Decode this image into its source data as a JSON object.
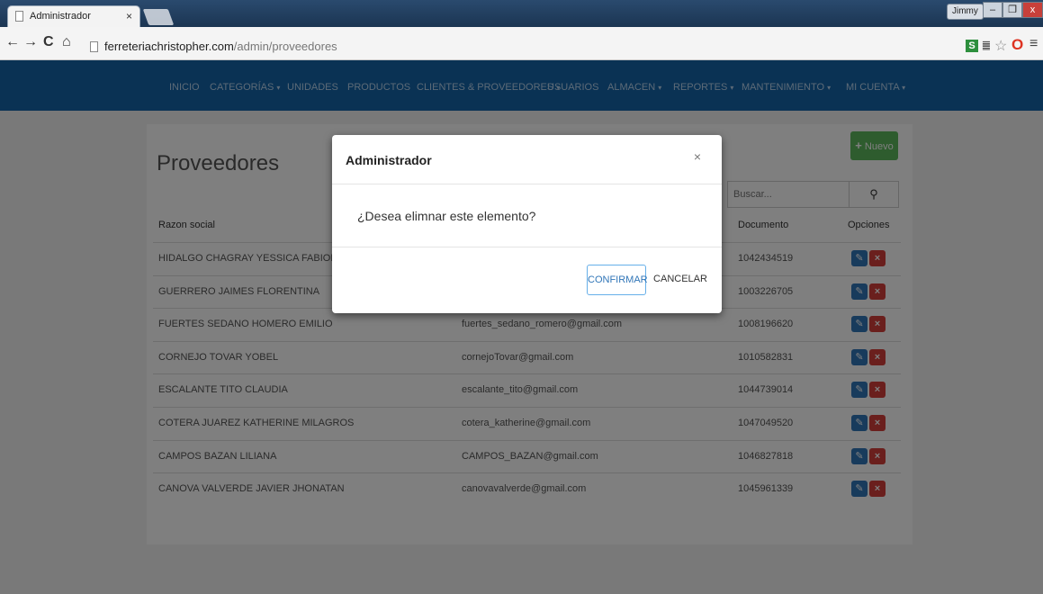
{
  "browser": {
    "tab_title": "Administrador",
    "tab_close": "×",
    "url_domain": "ferreteriachristopher.com",
    "url_path": "/admin/proveedores",
    "user": "Jimmy",
    "win_min": "–",
    "win_max": "❐",
    "win_close": "x",
    "back_icon": "←",
    "forward_icon": "→",
    "reload_icon": "C",
    "home_icon": "⌂",
    "ext_s": "S",
    "ext_t": "䷀",
    "star_icon": "☆",
    "opera_icon": "O",
    "menu_icon": "≡"
  },
  "nav": {
    "items": [
      {
        "label": "INICIO",
        "caret": false
      },
      {
        "label": "CATEGORÍAS",
        "caret": true
      },
      {
        "label": "UNIDADES",
        "caret": false
      },
      {
        "label": "PRODUCTOS",
        "caret": false
      },
      {
        "label": "CLIENTES & PROVEEDORES",
        "caret": true
      },
      {
        "label": "USUARIOS",
        "caret": false
      },
      {
        "label": "ALMACEN",
        "caret": true
      },
      {
        "label": "REPORTES",
        "caret": true
      },
      {
        "label": "MANTENIMIENTO",
        "caret": true
      },
      {
        "label": "MI CUENTA",
        "caret": true
      }
    ],
    "caret_glyph": "▾"
  },
  "page": {
    "title": "Proveedores",
    "new_button": "Nuevo",
    "new_icon": "+",
    "search_placeholder": "Buscar...",
    "search_icon": "⚲"
  },
  "table": {
    "headers": [
      "Razon social",
      "",
      "Documento",
      "Opciones"
    ],
    "edit_icon": "✎",
    "delete_icon": "×",
    "rows": [
      {
        "name": "HIDALGO CHAGRAY YESSICA FABIOLA",
        "email": "",
        "doc": "1042434519"
      },
      {
        "name": "GUERRERO JAIMES FLORENTINA",
        "email": "",
        "doc": "1003226705"
      },
      {
        "name": "FUERTES SEDANO HOMERO EMILIO",
        "email": "fuertes_sedano_romero@gmail.com",
        "doc": "1008196620"
      },
      {
        "name": "CORNEJO TOVAR YOBEL",
        "email": "cornejoTovar@gmail.com",
        "doc": "1010582831"
      },
      {
        "name": "ESCALANTE TITO CLAUDIA",
        "email": "escalante_tito@gmail.com",
        "doc": "1044739014"
      },
      {
        "name": "COTERA JUAREZ KATHERINE MILAGROS",
        "email": "cotera_katherine@gmail.com",
        "doc": "1047049520"
      },
      {
        "name": "CAMPOS BAZAN LILIANA",
        "email": "CAMPOS_BAZAN@gmail.com",
        "doc": "1046827818"
      },
      {
        "name": "CANOVA VALVERDE JAVIER JHONATAN",
        "email": "canovavalverde@gmail.com",
        "doc": "1045961339"
      }
    ]
  },
  "modal": {
    "title": "Administrador",
    "close": "×",
    "message": "¿Desea elimnar este elemento?",
    "confirm": "CONFIRMAR",
    "cancel": "CANCELAR"
  },
  "colors": {
    "navbar": "#1565a8",
    "success": "#5cb85c",
    "primary": "#3176b8",
    "danger": "#d43f3a"
  }
}
